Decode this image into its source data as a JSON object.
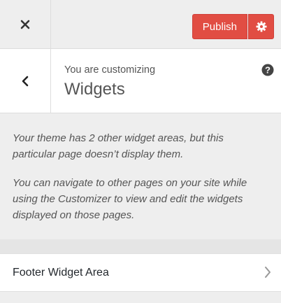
{
  "toolbar": {
    "publish_label": "Publish",
    "accent_color": "#e14d43"
  },
  "header": {
    "subtitle": "You are customizing",
    "title": "Widgets"
  },
  "description": {
    "paragraph1": "Your theme has 2 other widget areas, but this particular page doesn’t display them.",
    "paragraph2": "You can navigate to other pages on your site while using the Customizer to view and edit the widgets displayed on those pages."
  },
  "sections": [
    {
      "label": "Footer Widget Area"
    }
  ]
}
